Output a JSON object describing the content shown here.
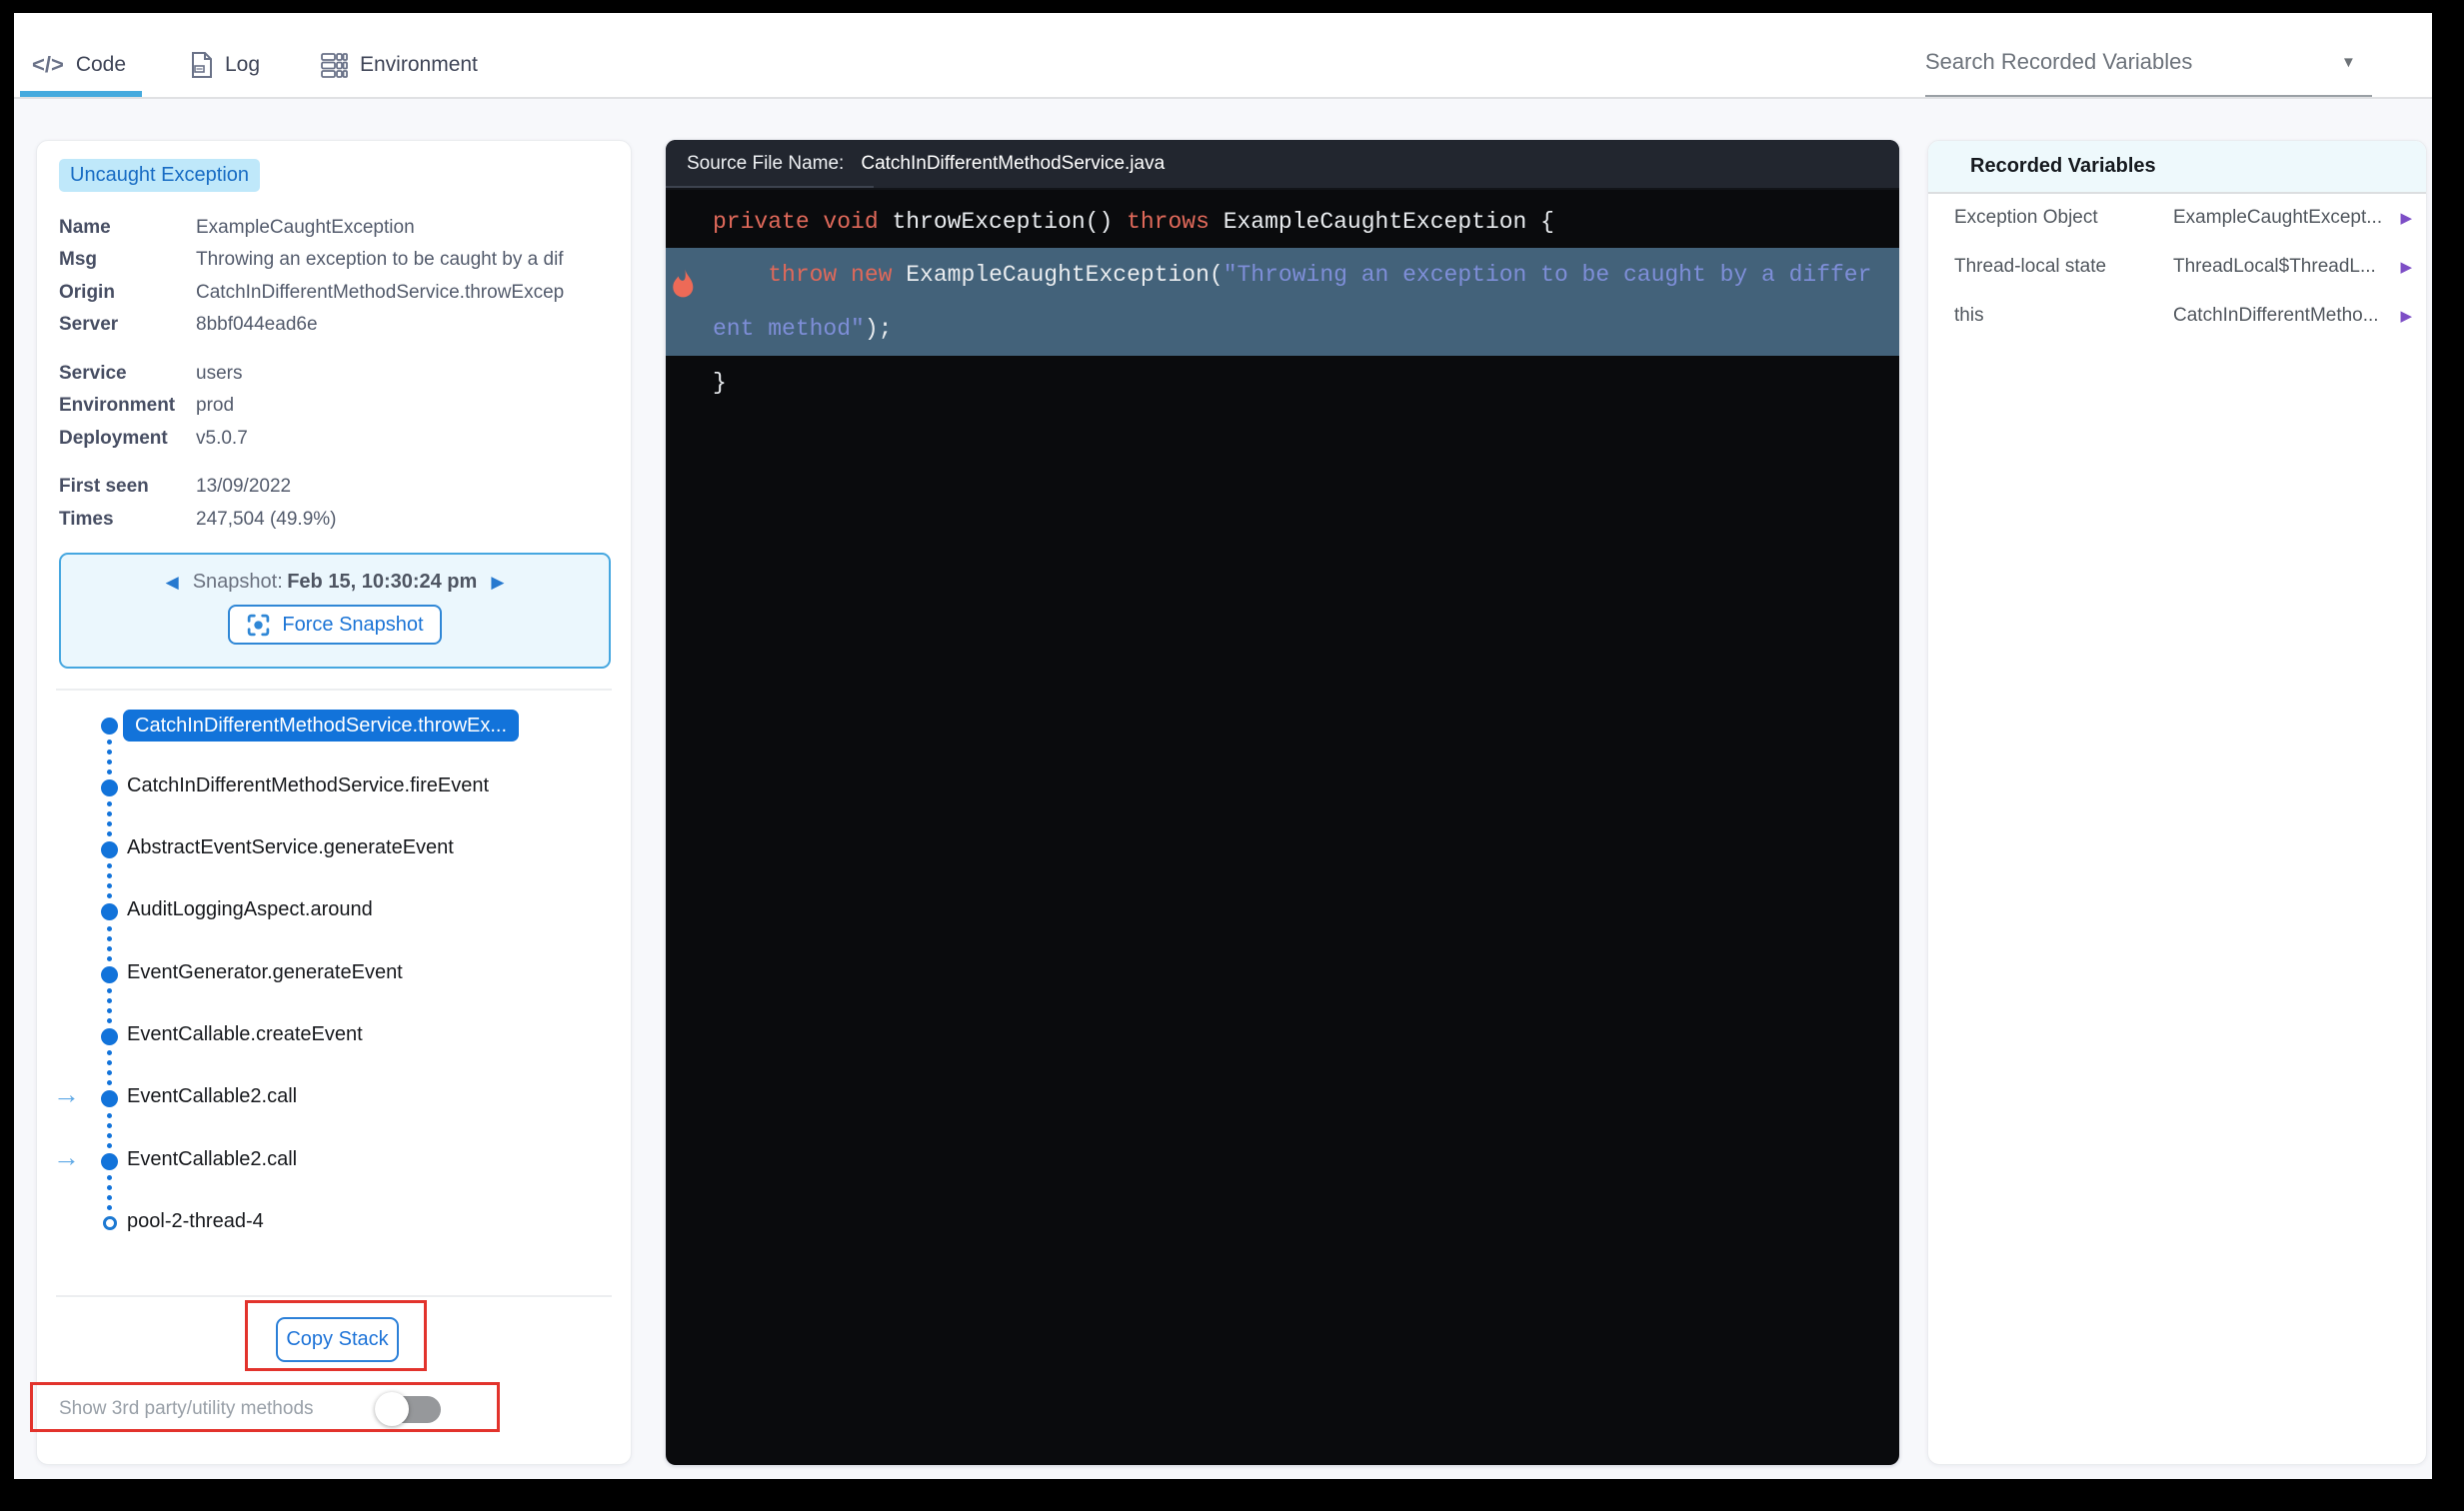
{
  "tabs": {
    "code": "Code",
    "log": "Log",
    "environment": "Environment"
  },
  "search": {
    "value": "Search Recorded Variables"
  },
  "exception": {
    "badge": "Uncaught Exception",
    "details": [
      {
        "label": "Name",
        "value": "ExampleCaughtException"
      },
      {
        "label": "Msg",
        "value": "Throwing an exception to be caught by a dif"
      },
      {
        "label": "Origin",
        "value": "CatchInDifferentMethodService.throwExcep"
      },
      {
        "label": "Server",
        "value": "8bbf044ead6e"
      },
      {
        "label": "Service",
        "value": "users"
      },
      {
        "label": "Environment",
        "value": "prod"
      },
      {
        "label": "Deployment",
        "value": "v5.0.7"
      },
      {
        "label": "First seen",
        "value": "13/09/2022"
      },
      {
        "label": "Times",
        "value": "247,504 (49.9%)"
      }
    ],
    "snapshot": {
      "label": "Snapshot:",
      "timestamp": "Feb 15, 10:30:24 pm",
      "force_button": "Force Snapshot"
    },
    "stack": [
      "CatchInDifferentMethodService.throwEx...",
      "CatchInDifferentMethodService.fireEvent",
      "AbstractEventService.generateEvent",
      "AuditLoggingAspect.around",
      "EventGenerator.generateEvent",
      "EventCallable.createEvent",
      "EventCallable2.call",
      "EventCallable2.call",
      "pool-2-thread-4"
    ],
    "copy_stack_button": "Copy Stack",
    "toggle_label": "Show 3rd party/utility methods",
    "toggle_state": "off"
  },
  "code": {
    "header_label": "Source File Name:",
    "file_name": "CatchInDifferentMethodService.java",
    "line1": {
      "kw1": "private ",
      "kw2": "void ",
      "plain1": "throwException() ",
      "kw3": "throws ",
      "plain2": "ExampleCaughtException {"
    },
    "line2a": {
      "kw1": "    throw ",
      "kw2": "new ",
      "plain1": "ExampleCaughtException(",
      "str1": "\"Throwing an exception to be caught by a differ"
    },
    "line2b": {
      "str1": "ent method\"",
      "plain1": ");"
    },
    "line3": "}"
  },
  "variables": {
    "title": "Recorded Variables",
    "rows": [
      {
        "name": "Exception Object",
        "value": "ExampleCaughtExcept..."
      },
      {
        "name": "Thread-local state",
        "value": "ThreadLocal$ThreadL..."
      },
      {
        "name": "this",
        "value": "CatchInDifferentMetho..."
      }
    ]
  },
  "colors": {
    "accent_blue": "#1273da",
    "tab_underline": "#45aade",
    "badge_bg": "#bfe8fa",
    "badge_text": "#186cc4",
    "snapshot_border": "#46a7e0",
    "button_blue": "#1f74d8",
    "annotation_red": "#e2332c",
    "variable_arrow_purple": "#7d4ec6",
    "stack_arrow_blue": "#5fa9e6",
    "code_keyword": "#e0695a",
    "code_string": "#7e8ed8",
    "code_highlight_bg": "#43627a",
    "code_header_bg": "#22262f",
    "code_bg": "#0a0b0d"
  }
}
